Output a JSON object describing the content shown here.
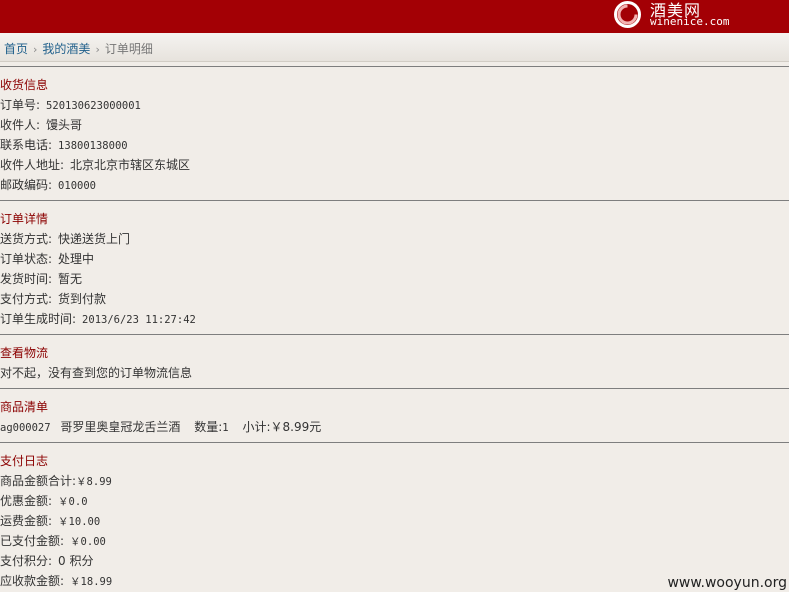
{
  "header": {
    "logo_cn": "酒美网",
    "logo_en": "winenice.com",
    "brand_color": "#a30005"
  },
  "breadcrumb": {
    "home": "首页",
    "my": "我的酒美",
    "current": "订单明细",
    "separator": "›"
  },
  "shipping": {
    "title": "收货信息",
    "order_no_label": "订单号:",
    "order_no": "520130623000001",
    "receiver_label": "收件人:",
    "receiver": "馒头哥",
    "phone_label": "联系电话:",
    "phone": "13800138000",
    "address_label": "收件人地址:",
    "address": "北京北京市辖区东城区",
    "zip_label": "邮政编码:",
    "zip": "010000"
  },
  "order": {
    "title": "订单详情",
    "delivery_label": "送货方式:",
    "delivery": "快递送货上门",
    "status_label": "订单状态:",
    "status": "处理中",
    "ship_time_label": "发货时间:",
    "ship_time": "暂无",
    "pay_method_label": "支付方式:",
    "pay_method": "货到付款",
    "created_label": "订单生成时间:",
    "created": "2013/6/23 11:27:42"
  },
  "logistics": {
    "title": "查看物流",
    "message": "对不起，没有查到您的订单物流信息"
  },
  "goods": {
    "title": "商品清单",
    "sku": "ag000027",
    "name": "哥罗里奥皇冠龙舌兰酒",
    "qty_label": "数量:",
    "qty": "1",
    "subtotal_label": "小计:",
    "subtotal": "￥8.99元"
  },
  "payment": {
    "title": "支付日志",
    "goods_total_label": "商品金额合计:",
    "goods_total": "￥8.99",
    "discount_label": "优惠金额:",
    "discount": "￥0.0",
    "freight_label": "运费金额:",
    "freight": "￥10.00",
    "paid_label": "已支付金额:",
    "paid": "￥0.00",
    "points_label": "支付积分:",
    "points": "0 积分",
    "due_label": "应收款金额:",
    "due": "￥18.99"
  },
  "watermark": "www.wooyun.org"
}
